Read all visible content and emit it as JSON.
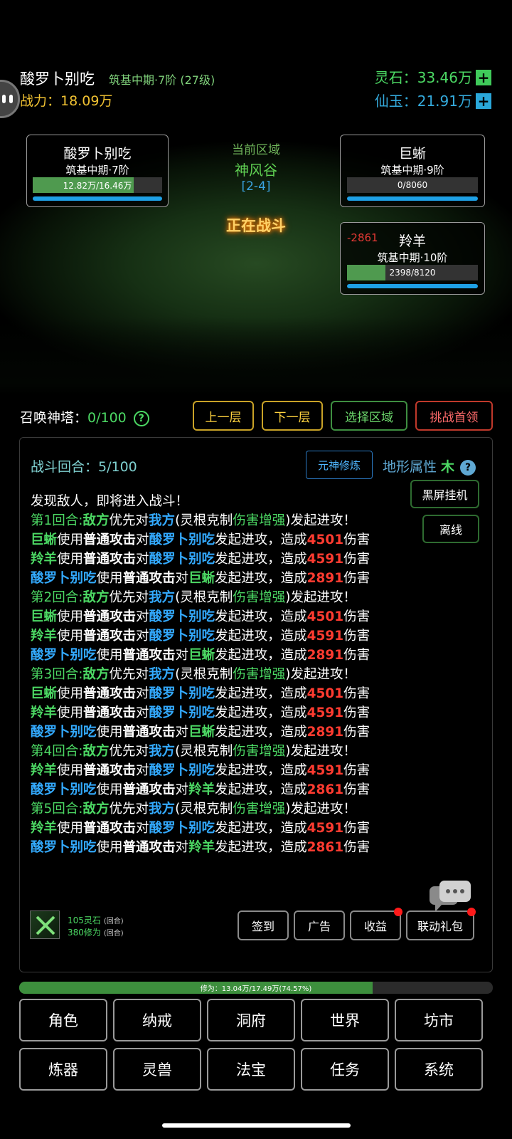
{
  "player": {
    "name": "酸罗卜别吃",
    "realm": "筑基中期·7阶 (27级)",
    "power_label": "战力：",
    "power_value": "18.09万"
  },
  "currency": {
    "lingshi": "灵石：33.46万",
    "xianyu": "仙玉：21.91万",
    "plus": "+"
  },
  "zone": {
    "title": "当前区域",
    "name": "神风谷",
    "code": "[2-4]",
    "status": "正在战斗"
  },
  "self_unit": {
    "name": "酸罗卜别吃",
    "realm": "筑基中期·7阶",
    "hp_text": "12.82万/16.46万",
    "hp_fraction": 0.779
  },
  "enemies": [
    {
      "name": "巨蜥",
      "realm": "筑基中期·9阶",
      "hp_text": "0/8060",
      "hp_fraction": 0.0,
      "damage": ""
    },
    {
      "name": "羚羊",
      "realm": "筑基中期·10阶",
      "hp_text": "2398/8120",
      "hp_fraction": 0.295,
      "damage": "-2861"
    }
  ],
  "tower": {
    "label": "召唤神塔：",
    "value": "0/100",
    "help": "?"
  },
  "nav_buttons": {
    "prev_floor": "上一层",
    "next_floor": "下一层",
    "select_zone": "选择区域",
    "challenge_boss": "挑战首领"
  },
  "battle": {
    "round_label": "战斗回合：5/100",
    "yuanshen_button": "元神修炼",
    "terrain_label": "地形属性",
    "terrain_value": "木",
    "help": "?",
    "blackscreen_button": "黑屏挂机",
    "offline_button": "离线"
  },
  "battle_log": [
    [
      {
        "t": "发现敌人，即将进入战斗！",
        "c": "w"
      }
    ],
    [
      {
        "t": "第1回合:",
        "c": "g"
      },
      {
        "t": "敌方",
        "c": "g",
        "b": true
      },
      {
        "t": "优先对",
        "c": "w"
      },
      {
        "t": "我方",
        "c": "b",
        "b": true
      },
      {
        "t": "(灵根克制",
        "c": "w"
      },
      {
        "t": "伤害增强",
        "c": "g"
      },
      {
        "t": ")发起进攻！",
        "c": "w"
      }
    ],
    [
      {
        "t": "巨蜥",
        "c": "g",
        "b": true
      },
      {
        "t": "使用",
        "c": "w"
      },
      {
        "t": "普通攻击",
        "c": "w",
        "b": true
      },
      {
        "t": "对",
        "c": "w"
      },
      {
        "t": "酸罗卜别吃",
        "c": "b",
        "b": true
      },
      {
        "t": "发起进攻，造成",
        "c": "w"
      },
      {
        "t": "4501",
        "c": "r",
        "b": true
      },
      {
        "t": "伤害",
        "c": "w"
      }
    ],
    [
      {
        "t": "羚羊",
        "c": "g",
        "b": true
      },
      {
        "t": "使用",
        "c": "w"
      },
      {
        "t": "普通攻击",
        "c": "w",
        "b": true
      },
      {
        "t": "对",
        "c": "w"
      },
      {
        "t": "酸罗卜别吃",
        "c": "b",
        "b": true
      },
      {
        "t": "发起进攻，造成",
        "c": "w"
      },
      {
        "t": "4591",
        "c": "r",
        "b": true
      },
      {
        "t": "伤害",
        "c": "w"
      }
    ],
    [
      {
        "t": "酸罗卜别吃",
        "c": "b",
        "b": true
      },
      {
        "t": "使用",
        "c": "w"
      },
      {
        "t": "普通攻击",
        "c": "w",
        "b": true
      },
      {
        "t": "对",
        "c": "w"
      },
      {
        "t": "巨蜥",
        "c": "g",
        "b": true
      },
      {
        "t": "发起进攻，造成",
        "c": "w"
      },
      {
        "t": "2891",
        "c": "r",
        "b": true
      },
      {
        "t": "伤害",
        "c": "w"
      }
    ],
    [
      {
        "t": "第2回合:",
        "c": "g"
      },
      {
        "t": "敌方",
        "c": "g",
        "b": true
      },
      {
        "t": "优先对",
        "c": "w"
      },
      {
        "t": "我方",
        "c": "b",
        "b": true
      },
      {
        "t": "(灵根克制",
        "c": "w"
      },
      {
        "t": "伤害增强",
        "c": "g"
      },
      {
        "t": ")发起进攻！",
        "c": "w"
      }
    ],
    [
      {
        "t": "巨蜥",
        "c": "g",
        "b": true
      },
      {
        "t": "使用",
        "c": "w"
      },
      {
        "t": "普通攻击",
        "c": "w",
        "b": true
      },
      {
        "t": "对",
        "c": "w"
      },
      {
        "t": "酸罗卜别吃",
        "c": "b",
        "b": true
      },
      {
        "t": "发起进攻，造成",
        "c": "w"
      },
      {
        "t": "4501",
        "c": "r",
        "b": true
      },
      {
        "t": "伤害",
        "c": "w"
      }
    ],
    [
      {
        "t": "羚羊",
        "c": "g",
        "b": true
      },
      {
        "t": "使用",
        "c": "w"
      },
      {
        "t": "普通攻击",
        "c": "w",
        "b": true
      },
      {
        "t": "对",
        "c": "w"
      },
      {
        "t": "酸罗卜别吃",
        "c": "b",
        "b": true
      },
      {
        "t": "发起进攻，造成",
        "c": "w"
      },
      {
        "t": "4591",
        "c": "r",
        "b": true
      },
      {
        "t": "伤害",
        "c": "w"
      }
    ],
    [
      {
        "t": "酸罗卜别吃",
        "c": "b",
        "b": true
      },
      {
        "t": "使用",
        "c": "w"
      },
      {
        "t": "普通攻击",
        "c": "w",
        "b": true
      },
      {
        "t": "对",
        "c": "w"
      },
      {
        "t": "巨蜥",
        "c": "g",
        "b": true
      },
      {
        "t": "发起进攻，造成",
        "c": "w"
      },
      {
        "t": "2891",
        "c": "r",
        "b": true
      },
      {
        "t": "伤害",
        "c": "w"
      }
    ],
    [
      {
        "t": "第3回合:",
        "c": "g"
      },
      {
        "t": "敌方",
        "c": "g",
        "b": true
      },
      {
        "t": "优先对",
        "c": "w"
      },
      {
        "t": "我方",
        "c": "b",
        "b": true
      },
      {
        "t": "(灵根克制",
        "c": "w"
      },
      {
        "t": "伤害增强",
        "c": "g"
      },
      {
        "t": ")发起进攻！",
        "c": "w"
      }
    ],
    [
      {
        "t": "巨蜥",
        "c": "g",
        "b": true
      },
      {
        "t": "使用",
        "c": "w"
      },
      {
        "t": "普通攻击",
        "c": "w",
        "b": true
      },
      {
        "t": "对",
        "c": "w"
      },
      {
        "t": "酸罗卜别吃",
        "c": "b",
        "b": true
      },
      {
        "t": "发起进攻，造成",
        "c": "w"
      },
      {
        "t": "4501",
        "c": "r",
        "b": true
      },
      {
        "t": "伤害",
        "c": "w"
      }
    ],
    [
      {
        "t": "羚羊",
        "c": "g",
        "b": true
      },
      {
        "t": "使用",
        "c": "w"
      },
      {
        "t": "普通攻击",
        "c": "w",
        "b": true
      },
      {
        "t": "对",
        "c": "w"
      },
      {
        "t": "酸罗卜别吃",
        "c": "b",
        "b": true
      },
      {
        "t": "发起进攻，造成",
        "c": "w"
      },
      {
        "t": "4591",
        "c": "r",
        "b": true
      },
      {
        "t": "伤害",
        "c": "w"
      }
    ],
    [
      {
        "t": "酸罗卜别吃",
        "c": "b",
        "b": true
      },
      {
        "t": "使用",
        "c": "w"
      },
      {
        "t": "普通攻击",
        "c": "w",
        "b": true
      },
      {
        "t": "对",
        "c": "w"
      },
      {
        "t": "巨蜥",
        "c": "g",
        "b": true
      },
      {
        "t": "发起进攻，造成",
        "c": "w"
      },
      {
        "t": "2891",
        "c": "r",
        "b": true
      },
      {
        "t": "伤害",
        "c": "w"
      }
    ],
    [
      {
        "t": "第4回合:",
        "c": "g"
      },
      {
        "t": "敌方",
        "c": "g",
        "b": true
      },
      {
        "t": "优先对",
        "c": "w"
      },
      {
        "t": "我方",
        "c": "b",
        "b": true
      },
      {
        "t": "(灵根克制",
        "c": "w"
      },
      {
        "t": "伤害增强",
        "c": "g"
      },
      {
        "t": ")发起进攻！",
        "c": "w"
      }
    ],
    [
      {
        "t": "羚羊",
        "c": "g",
        "b": true
      },
      {
        "t": "使用",
        "c": "w"
      },
      {
        "t": "普通攻击",
        "c": "w",
        "b": true
      },
      {
        "t": "对",
        "c": "w"
      },
      {
        "t": "酸罗卜别吃",
        "c": "b",
        "b": true
      },
      {
        "t": "发起进攻，造成",
        "c": "w"
      },
      {
        "t": "4591",
        "c": "r",
        "b": true
      },
      {
        "t": "伤害",
        "c": "w"
      }
    ],
    [
      {
        "t": "酸罗卜别吃",
        "c": "b",
        "b": true
      },
      {
        "t": "使用",
        "c": "w"
      },
      {
        "t": "普通攻击",
        "c": "w",
        "b": true
      },
      {
        "t": "对",
        "c": "w"
      },
      {
        "t": "羚羊",
        "c": "g",
        "b": true
      },
      {
        "t": "发起进攻，造成",
        "c": "w"
      },
      {
        "t": "2861",
        "c": "r",
        "b": true
      },
      {
        "t": "伤害",
        "c": "w"
      }
    ],
    [
      {
        "t": "第5回合:",
        "c": "g"
      },
      {
        "t": "敌方",
        "c": "g",
        "b": true
      },
      {
        "t": "优先对",
        "c": "w"
      },
      {
        "t": "我方",
        "c": "b",
        "b": true
      },
      {
        "t": "(灵根克制",
        "c": "w"
      },
      {
        "t": "伤害增强",
        "c": "g"
      },
      {
        "t": ")发起进攻！",
        "c": "w"
      }
    ],
    [
      {
        "t": "羚羊",
        "c": "g",
        "b": true
      },
      {
        "t": "使用",
        "c": "w"
      },
      {
        "t": "普通攻击",
        "c": "w",
        "b": true
      },
      {
        "t": "对",
        "c": "w"
      },
      {
        "t": "酸罗卜别吃",
        "c": "b",
        "b": true
      },
      {
        "t": "发起进攻，造成",
        "c": "w"
      },
      {
        "t": "4591",
        "c": "r",
        "b": true
      },
      {
        "t": "伤害",
        "c": "w"
      }
    ],
    [
      {
        "t": "酸罗卜别吃",
        "c": "b",
        "b": true
      },
      {
        "t": "使用",
        "c": "w"
      },
      {
        "t": "普通攻击",
        "c": "w",
        "b": true
      },
      {
        "t": "对",
        "c": "w"
      },
      {
        "t": "羚羊",
        "c": "g",
        "b": true
      },
      {
        "t": "发起进攻，造成",
        "c": "w"
      },
      {
        "t": "2861",
        "c": "r",
        "b": true
      },
      {
        "t": "伤害",
        "c": "w"
      }
    ]
  ],
  "rewards": {
    "lingshi": "105灵石",
    "xiuwei": "380修为",
    "per_round": "(回合)"
  },
  "bottom_buttons": {
    "checkin": "签到",
    "ads": "广告",
    "income": "收益",
    "gift": "联动礼包"
  },
  "xp": {
    "text": "修为：13.04万/17.49万(74.57%)",
    "fraction": 0.7457
  },
  "menu": [
    [
      "角色",
      "纳戒",
      "洞府",
      "世界",
      "坊市"
    ],
    [
      "炼器",
      "灵兽",
      "法宝",
      "任务",
      "系统"
    ]
  ],
  "colors": {
    "green": "#4cd964",
    "blue": "#33aaff",
    "red": "#ff3b30",
    "gold": "#ffd23f"
  }
}
